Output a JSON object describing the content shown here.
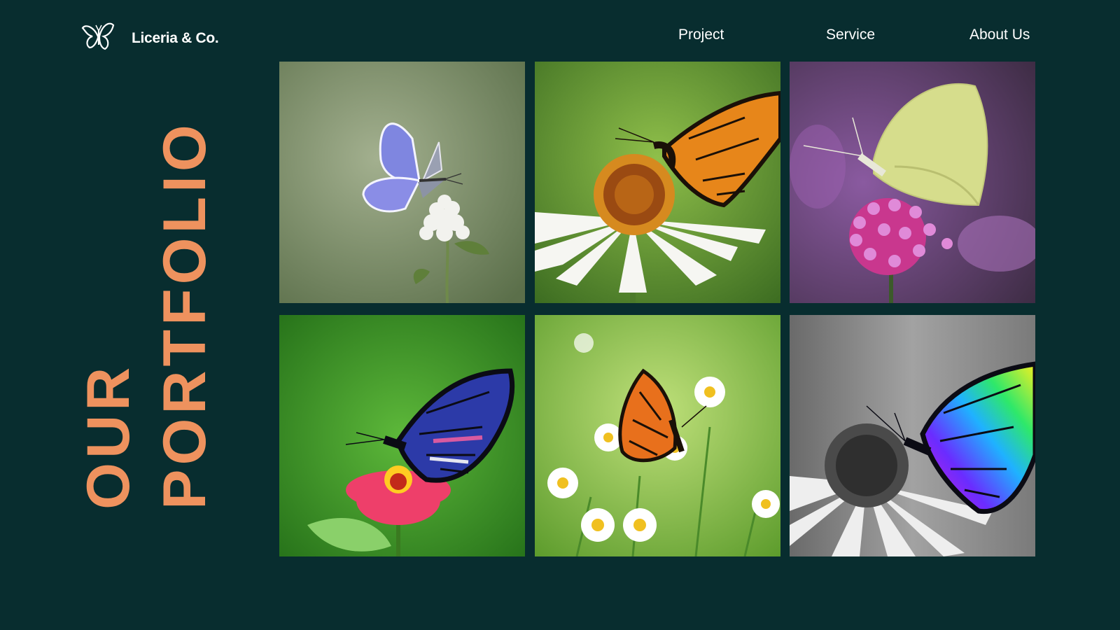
{
  "brand": {
    "name": "Liceria & Co.",
    "icon": "butterfly-icon"
  },
  "nav": {
    "items": [
      "Project",
      "Service",
      "About Us"
    ]
  },
  "headline": {
    "line1": "OUR",
    "line2": "PORTFOLIO"
  },
  "colors": {
    "background": "#082d2f",
    "accent": "#ee925e",
    "text": "#ffffff"
  },
  "gallery": {
    "photos": [
      {
        "subject": "blue-butterfly-on-clover",
        "bg": "#7a8f66"
      },
      {
        "subject": "monarch-on-coneflower",
        "bg": "#6f9a3b"
      },
      {
        "subject": "white-butterfly-on-verbena",
        "bg": "#7a4a86"
      },
      {
        "subject": "blue-pink-butterfly-on-zinnia",
        "bg": "#3e9a2a"
      },
      {
        "subject": "monarch-on-daisies",
        "bg": "#8fc05a"
      },
      {
        "subject": "rainbow-butterfly-on-grayscale-flower",
        "bg": "#8a8a8a"
      }
    ]
  }
}
